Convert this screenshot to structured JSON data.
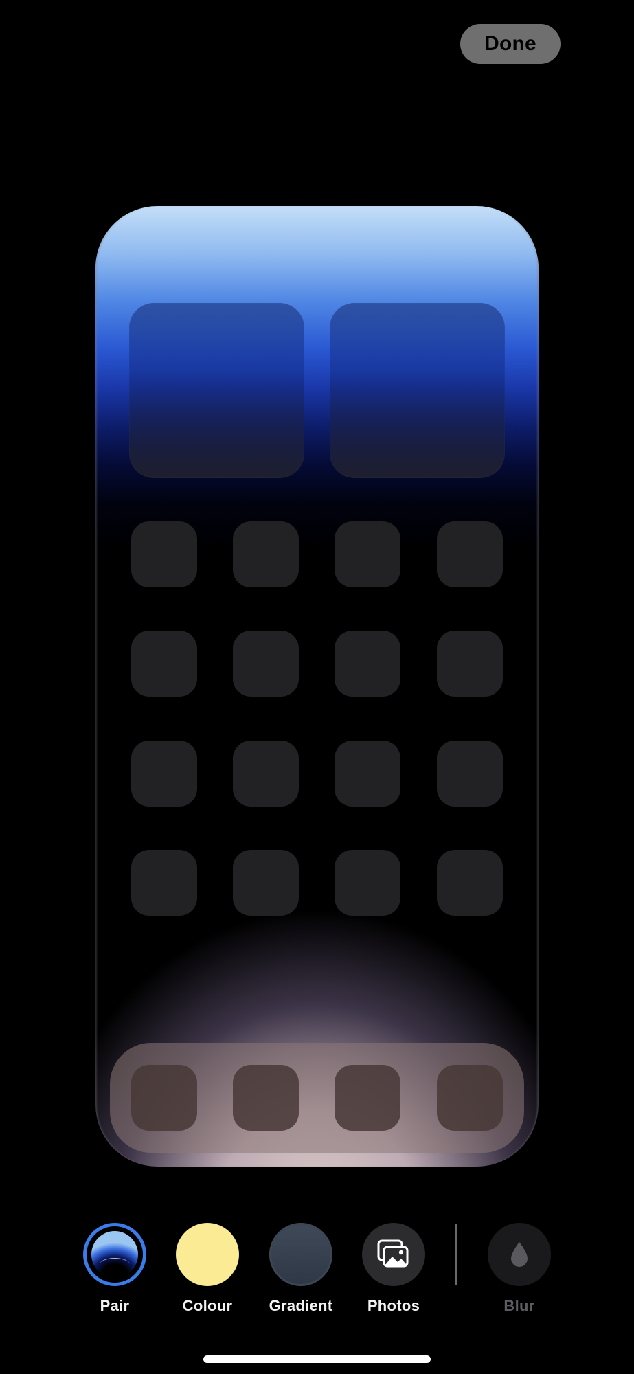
{
  "header": {
    "done_label": "Done"
  },
  "toolbar": {
    "options": [
      {
        "label": "Pair",
        "icon": "wallpaper-pair-icon",
        "selected": true
      },
      {
        "label": "Colour",
        "icon": "colour-swatch-icon",
        "color": "#faeb94"
      },
      {
        "label": "Gradient",
        "icon": "gradient-swatch-icon"
      },
      {
        "label": "Photos",
        "icon": "photos-icon"
      },
      {
        "label": "Blur",
        "icon": "blur-drop-icon",
        "disabled": true
      }
    ]
  },
  "colors": {
    "accent": "#3a7dea",
    "selected_colour": "#faeb94",
    "done_button_bg": "#6f6f6f"
  }
}
